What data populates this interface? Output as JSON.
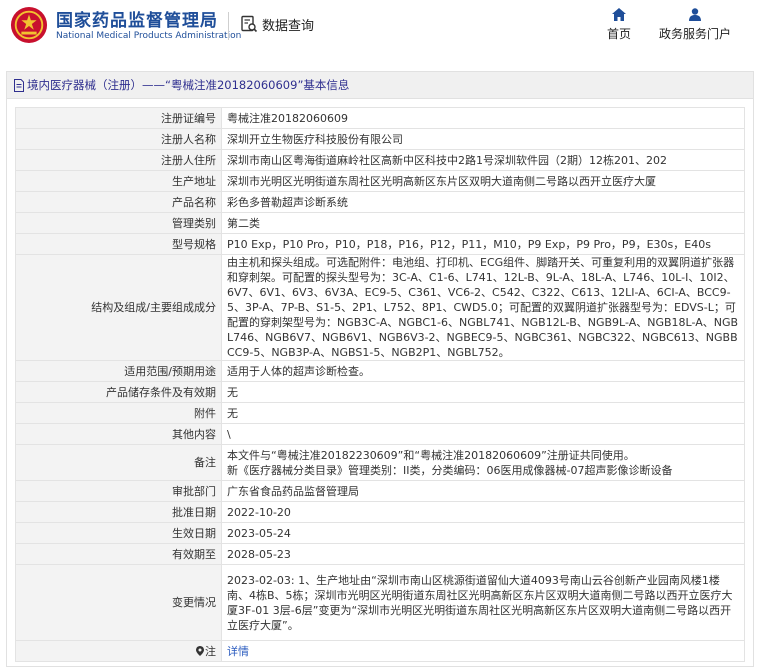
{
  "header": {
    "brand_cn": "国家药品监督管理局",
    "brand_en": "National Medical Products Administration",
    "query_label": "数据查询",
    "nav": [
      {
        "label": "首页",
        "icon": "home-icon"
      },
      {
        "label": "政务服务门户",
        "icon": "user-icon"
      }
    ],
    "brand_color": "#1f4e99",
    "emblem_color": "#c8102e"
  },
  "panel": {
    "title": "境内医疗器械（注册）——“粤械注准20182060609”基本信息"
  },
  "rows": [
    {
      "label": "注册证编号",
      "value": "粤械注准20182060609"
    },
    {
      "label": "注册人名称",
      "value": "深圳开立生物医疗科技股份有限公司"
    },
    {
      "label": "注册人住所",
      "value": "深圳市南山区粤海街道麻岭社区高新中区科技中2路1号深圳软件园（2期）12栋201、202"
    },
    {
      "label": "生产地址",
      "value": "深圳市光明区光明街道东周社区光明高新区东片区双明大道南侧二号路以西开立医疗大厦"
    },
    {
      "label": "产品名称",
      "value": "彩色多普勒超声诊断系统"
    },
    {
      "label": "管理类别",
      "value": "第二类"
    },
    {
      "label": "型号规格",
      "value": "P10 Exp，P10 Pro，P10，P18，P16，P12，P11，M10，P9 Exp，P9 Pro，P9，E30s，E40s"
    },
    {
      "label": "结构及组成/主要组成成分",
      "value": "由主机和探头组成。可选配附件：电池组、打印机、ECG组件、脚踏开关、可重复利用的双翼阴道扩张器和穿刺架。可配置的探头型号为：3C-A、C1-6、L741、12L-B、9L-A、18L-A、L746、10L-I、10I2、6V7、6V1、6V3、6V3A、EC9-5、C361、VC6-2、C542、C322、C613、12LI-A、6CI-A、BCC9-5、3P-A、7P-B、S1-5、2P1、L752、8P1、CWD5.0；可配置的双翼阴道扩张器型号为：EDVS-L；可配置的穿刺架型号为：NGB3C-A、NGBC1-6、NGBL741、NGB12L-B、NGB9L-A、NGB18L-A、NGBL746、NGB6V7、NGB6V1、NGB6V3-2、NGBEC9-5、NGBC361、NGBC322、NGBC613、NGBBCC9-5、NGB3P-A、NGBS1-5、NGB2P1、NGBL752。"
    },
    {
      "label": "适用范围/预期用途",
      "value": "适用于人体的超声诊断检查。"
    },
    {
      "label": "产品储存条件及有效期",
      "value": "无"
    },
    {
      "label": "附件",
      "value": "无"
    },
    {
      "label": "其他内容",
      "value": "\\"
    },
    {
      "label": "备注",
      "value": "本文件与“粤械注准20182230609”和“粤械注准20182060609”注册证共同使用。\n新《医疗器械分类目录》管理类别：II类，分类编码：06医用成像器械-07超声影像诊断设备"
    },
    {
      "label": "审批部门",
      "value": "广东省食品药品监督管理局"
    },
    {
      "label": "批准日期",
      "value": "2022-10-20"
    },
    {
      "label": "生效日期",
      "value": "2023-05-24"
    },
    {
      "label": "有效期至",
      "value": "2028-05-23"
    },
    {
      "label": "变更情况",
      "value": "2023-02-03: 1、生产地址由“深圳市南山区桃源街道留仙大道4093号南山云谷创新产业园南风楼1楼南、4栋B、5栋；深圳市光明区光明街道东周社区光明高新区东片区双明大道南侧二号路以西开立医疗大厦3F-01 3层-6层”变更为“深圳市光明区光明街道东周社区光明高新区东片区双明大道南侧二号路以西开立医疗大厦”。"
    },
    {
      "label": "注",
      "value": "详情"
    }
  ]
}
